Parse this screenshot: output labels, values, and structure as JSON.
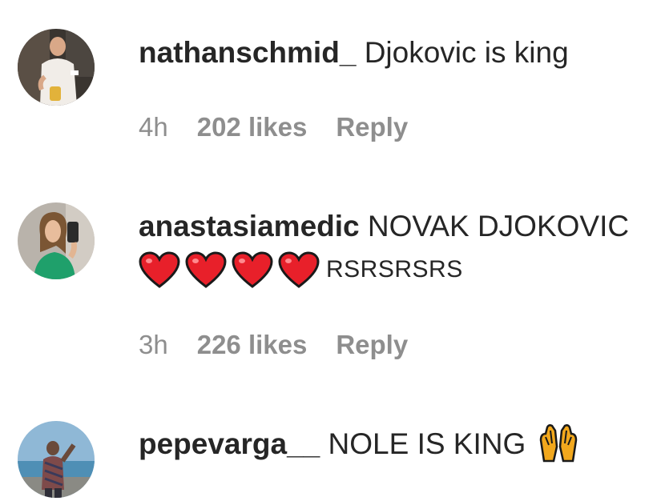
{
  "comments": [
    {
      "username": "nathanschmid_",
      "text": "Djokovic is king",
      "time": "4h",
      "likes": "202 likes",
      "reply": "Reply",
      "avatar_icon": "avatar-man-white-shirt"
    },
    {
      "username": "anastasiamedic",
      "text": "NOVAK DJOKOVIC",
      "text2": "RSRSRSRS",
      "emoji_icon": "red-heart-icon",
      "emoji_count": 4,
      "time": "3h",
      "likes": "226 likes",
      "reply": "Reply",
      "avatar_icon": "avatar-woman-selfie"
    },
    {
      "username": "pepevarga__",
      "text": "NOLE IS KING",
      "emoji_icon": "raising-hands-icon",
      "avatar_icon": "avatar-man-seaside"
    }
  ],
  "colors": {
    "text": "#262626",
    "meta": "#8e8e8e",
    "heart": "#e8202a",
    "hands": "#f2a81d"
  }
}
